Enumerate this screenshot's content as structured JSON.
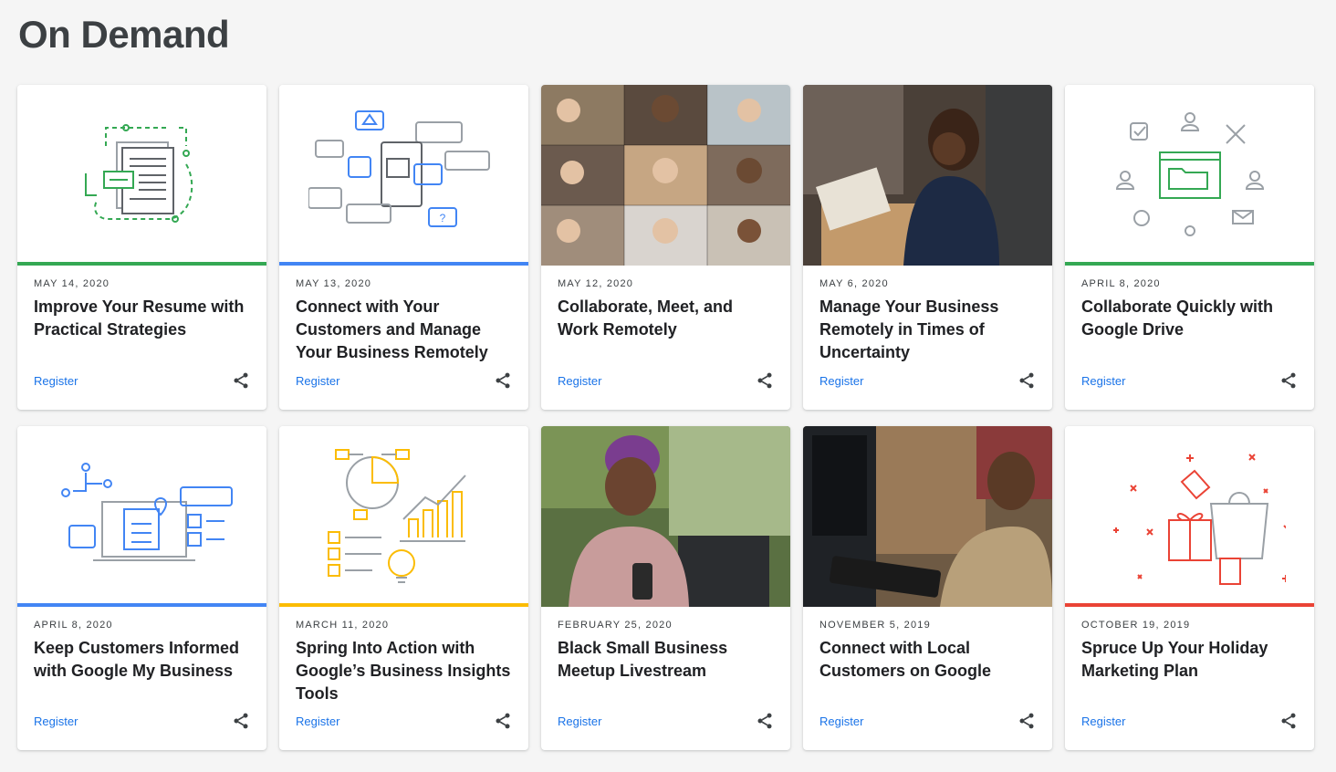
{
  "page": {
    "title": "On Demand"
  },
  "colors": {
    "green": "#34a853",
    "blue": "#4285f4",
    "yellow": "#fbbc04",
    "red": "#ea4335",
    "link": "#1a73e8"
  },
  "cards": [
    {
      "date": "MAY 14, 2020",
      "title": "Improve Your Resume with Practical Strategies",
      "register": "Register",
      "image": "resume-illustration"
    },
    {
      "date": "MAY 13, 2020",
      "title": "Connect with Your Customers and Manage Your Business Remotely",
      "register": "Register",
      "image": "customer-chat-illustration"
    },
    {
      "date": "MAY 12, 2020",
      "title": "Collaborate, Meet, and Work Remotely",
      "register": "Register",
      "image": "video-call-photo"
    },
    {
      "date": "MAY 6, 2020",
      "title": "Manage Your Business Remotely in Times of Uncertainty",
      "register": "Register",
      "image": "woman-laptop-photo"
    },
    {
      "date": "APRIL 8, 2020",
      "title": "Collaborate Quickly with Google Drive",
      "register": "Register",
      "image": "drive-folder-illustration"
    },
    {
      "date": "APRIL 8, 2020",
      "title": "Keep Customers Informed with Google My Business",
      "register": "Register",
      "image": "business-profile-illustration"
    },
    {
      "date": "MARCH 11, 2020",
      "title": "Spring Into Action with Google’s Business Insights Tools",
      "register": "Register",
      "image": "insights-illustration"
    },
    {
      "date": "FEBRUARY 25, 2020",
      "title": "Black Small Business Meetup Livestream",
      "register": "Register",
      "image": "woman-smiling-photo"
    },
    {
      "date": "NOVEMBER 5, 2019",
      "title": "Connect with Local Customers on Google",
      "register": "Register",
      "image": "man-computer-photo"
    },
    {
      "date": "OCTOBER 19, 2019",
      "title": "Spruce Up Your Holiday Marketing Plan",
      "register": "Register",
      "image": "holiday-shopping-illustration"
    }
  ]
}
